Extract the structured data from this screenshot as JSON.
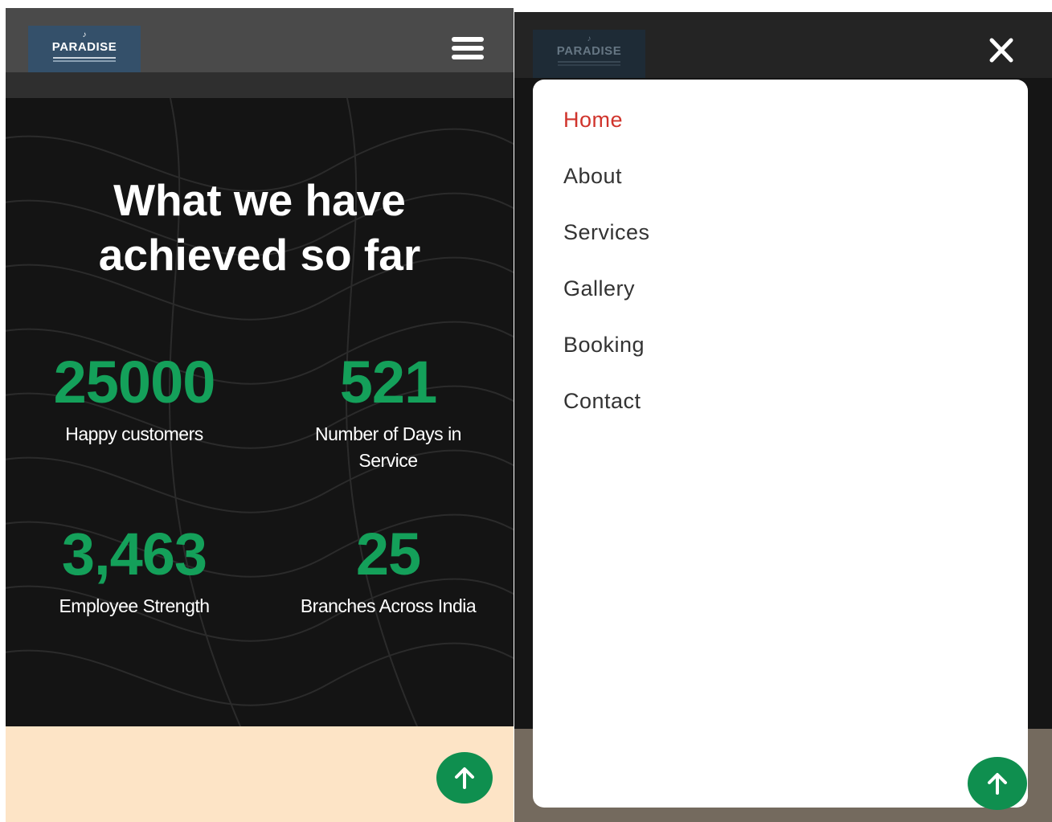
{
  "brand": {
    "name": "PARADISE",
    "colors": {
      "accent_green": "#14a05a",
      "scroll_button_green": "#0f8f4f",
      "active_menu_red": "#d0342c",
      "logo_blue": "#34506a",
      "footer_peach": "#fde4c6"
    }
  },
  "left_view": {
    "header": {
      "menu_button_icon": "hamburger-icon"
    },
    "hero": {
      "title_line1": "What we have",
      "title_line2": "achieved so far"
    },
    "stats": [
      {
        "number": "25000",
        "label": "Happy customers"
      },
      {
        "number": "521",
        "label_line1": "Number of Days in",
        "label_line2": "Service"
      },
      {
        "number": "3,463",
        "label": "Employee Strength"
      },
      {
        "number": "25",
        "label": "Branches Across India"
      }
    ],
    "scroll_top_icon": "arrow-up-icon"
  },
  "right_view": {
    "header": {
      "close_button_icon": "close-icon"
    },
    "menu": {
      "active_index": 0,
      "items": [
        {
          "label": "Home"
        },
        {
          "label": "About"
        },
        {
          "label": "Services"
        },
        {
          "label": "Gallery"
        },
        {
          "label": "Booking"
        },
        {
          "label": "Contact"
        }
      ]
    },
    "scroll_top_icon": "arrow-up-icon"
  }
}
